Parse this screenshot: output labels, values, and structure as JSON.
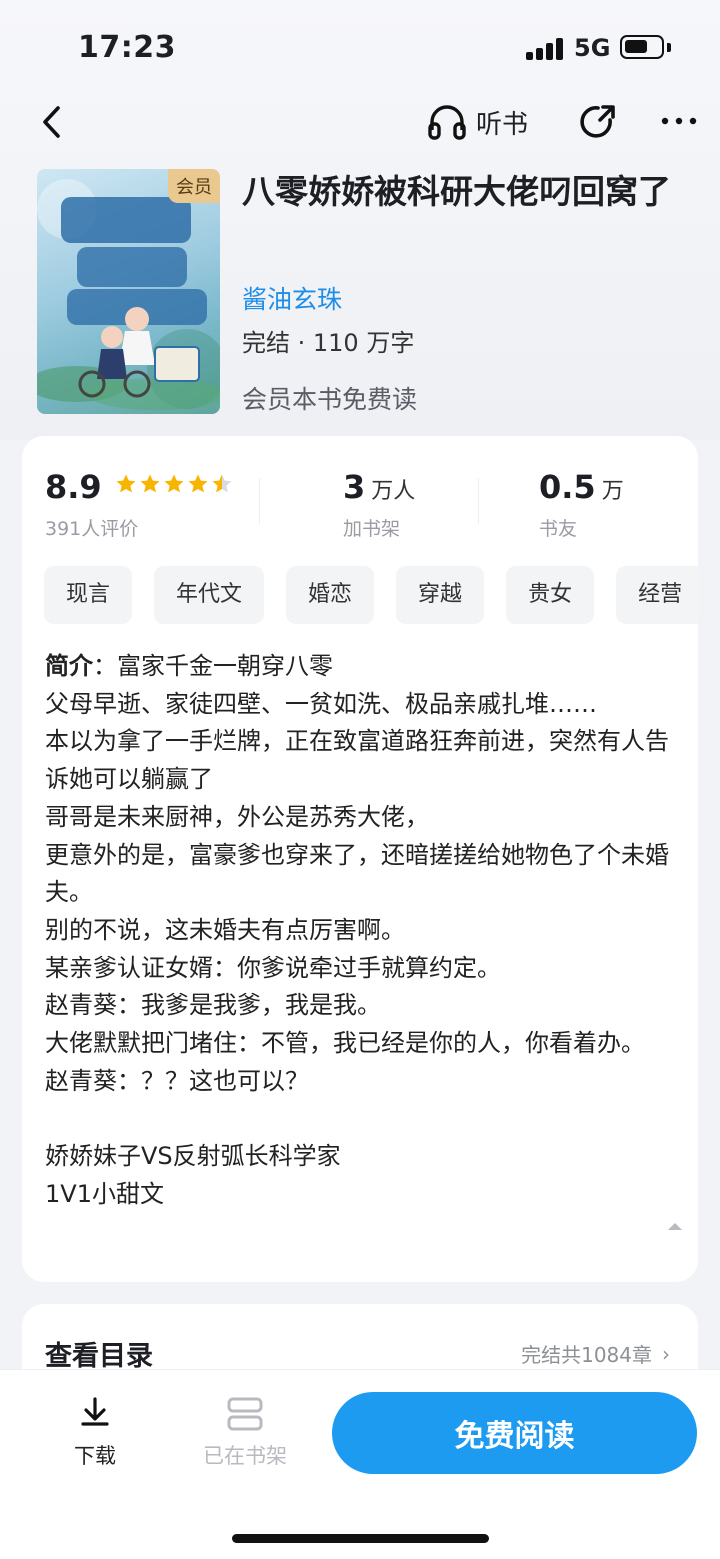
{
  "status_bar": {
    "time": "17:23",
    "network": "5G",
    "battery_percent": 65
  },
  "nav": {
    "listen_label": "听书"
  },
  "book": {
    "cover_badge": "会员",
    "title": "八零娇娇被科研大佬叼回窝了",
    "author": "酱油玄珠",
    "status": "完结 · 110 万字",
    "vip_note": "会员本书免费读"
  },
  "stats": {
    "rating": {
      "value": "8.9",
      "stars": 4.5,
      "sub": "391人评价"
    },
    "shelf": {
      "value": "3",
      "unit": "万人",
      "sub": "加书架"
    },
    "fans": {
      "value": "0.5",
      "unit": "万",
      "sub": "书友"
    }
  },
  "tags": [
    "现言",
    "年代文",
    "婚恋",
    "穿越",
    "贵女",
    "经营"
  ],
  "intro": {
    "label": "简介",
    "text": "：富家千金一朝穿八零\n父母早逝、家徒四壁、一贫如洗、极品亲戚扎堆……\n本以为拿了一手烂牌，正在致富道路狂奔前进，突然有人告诉她可以躺赢了\n哥哥是未来厨神，外公是苏秀大佬，\n更意外的是，富豪爹也穿来了，还暗搓搓给她物色了个未婚夫。\n别的不说，这未婚夫有点厉害啊。\n某亲爹认证女婿：你爹说牵过手就算约定。\n赵青葵：我爹是我爹，我是我。\n大佬默默把门堵住：不管，我已经是你的人，你看着办。\n赵青葵：？？这也可以？\n\n娇娇妹子VS反射弧长科学家\n1V1小甜文"
  },
  "catalog": {
    "title": "查看目录",
    "info": "完结共1084章"
  },
  "bottom": {
    "download_label": "下载",
    "shelf_label": "已在书架",
    "read_label": "免费阅读"
  },
  "colors": {
    "accent": "#1d9bf0",
    "author_link": "#1e8de8",
    "star": "#f7b500"
  }
}
